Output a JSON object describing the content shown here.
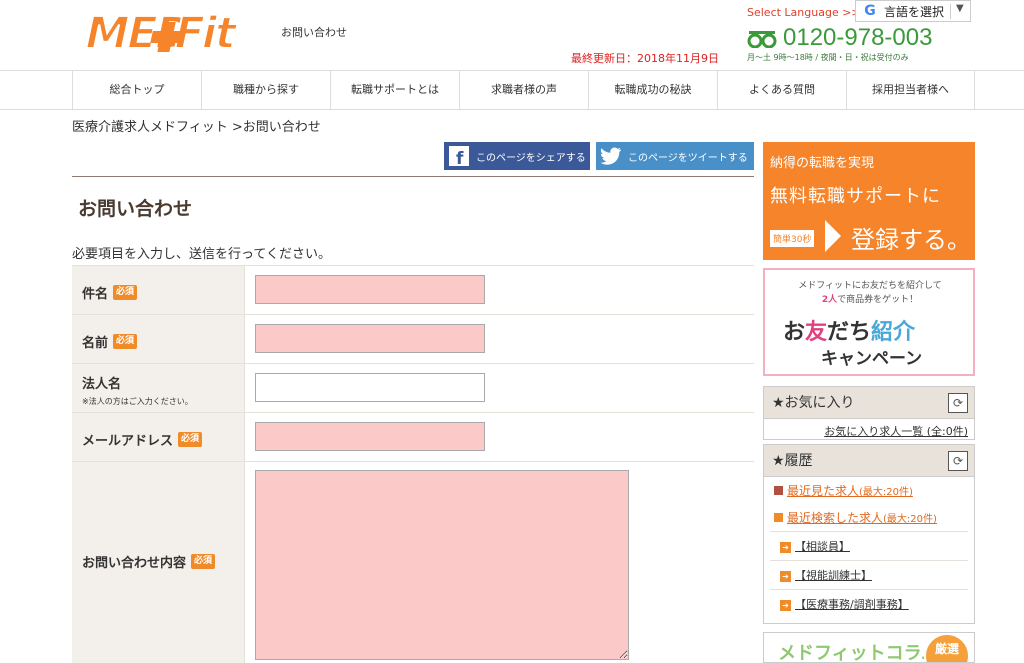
{
  "header": {
    "logo_text": "MED+Fit",
    "page_name": "お問い合わせ",
    "select_language": "Select Language >>",
    "lang_widget_label": "言語を選択",
    "updated": "最終更新日：2018年11月9日",
    "phone": "0120-978-003",
    "hours": "月〜土 9時〜18時 / 夜間・日・祝は受付のみ",
    "phone_icon_color": "#3a9a3a"
  },
  "nav": {
    "items": [
      {
        "label": "総合トップ"
      },
      {
        "label": "職種から探す"
      },
      {
        "label": "転職サポートとは"
      },
      {
        "label": "求職者様の声"
      },
      {
        "label": "転職成功の秘訣"
      },
      {
        "label": "よくある質問"
      },
      {
        "label": "採用担当者様へ"
      }
    ]
  },
  "breadcrumb": "医療介護求人メドフィット >お問い合わせ",
  "share": {
    "facebook": "このページをシェアする",
    "twitter": "このページをツイートする"
  },
  "page_title": "お問い合わせ",
  "instructions": "必要項目を入力し、送信を行ってください。",
  "form": {
    "required_badge": "必須",
    "fields": [
      {
        "label": "件名",
        "required": true,
        "value": ""
      },
      {
        "label": "名前",
        "required": true,
        "value": ""
      },
      {
        "label": "法人名",
        "required": false,
        "note": "※法人の方はご入力ください。",
        "value": ""
      },
      {
        "label": "メールアドレス",
        "required": true,
        "value": ""
      },
      {
        "label": "お問い合わせ内容",
        "required": true,
        "value": ""
      }
    ]
  },
  "sidebar": {
    "register_banner": {
      "line1": "納得の転職を実現",
      "line2": "無料転職サポートに",
      "badge": "簡単30秒",
      "cta": "登録する。"
    },
    "friend_banner": {
      "line1": "メドフィットにお友だちを紹介して",
      "line2_highlight": "2人",
      "line2_rest": "で商品券をゲット！",
      "title_a": "お",
      "title_b": "友",
      "title_c": "だち",
      "title_d": "紹介",
      "title_e": "キャンペーン"
    },
    "favorites": {
      "heading": "★お気に入り",
      "link": "お気に入り求人一覧 (全:0件)"
    },
    "history": {
      "heading": "★履歴",
      "recent_viewed": "最近見た求人",
      "recent_viewed_note": "(最大:20件)",
      "recent_searched": "最近検索した求人",
      "recent_searched_note": "(最大:20件)",
      "items": [
        "【相談員】",
        "【視能訓練士】",
        "【医療事務/調剤事務】"
      ]
    },
    "column_banner": {
      "title": "メドフィットコラム",
      "badge": "厳選"
    }
  },
  "colors": {
    "brand_orange": "#f5842a",
    "required_orange": "#f08b2a",
    "field_pink": "#fcc9c9",
    "facebook_blue": "#3b5998",
    "twitter_blue": "#4a90c8",
    "phone_green": "#3a9a3a"
  }
}
